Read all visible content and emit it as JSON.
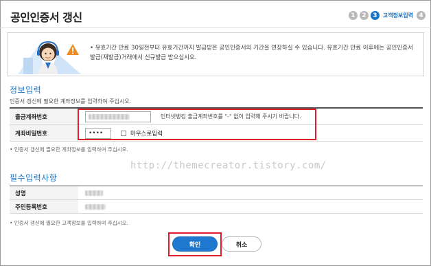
{
  "page": {
    "title": "공인인증서 갱신"
  },
  "steps": {
    "items": [
      "1",
      "2",
      "3",
      "4"
    ],
    "active_index": 2,
    "active_label": "고객정보입력"
  },
  "notice": {
    "text": "• 유효기간 만료 30일전부터 유효기간까지 발급받은 공인인증서의 기간을 연장하실 수 있습니다. 유효기간 만료 이후에는 공인인증서 발급(재발급)거래에서 신규발급 받으십시오."
  },
  "info_section": {
    "title": "정보입력",
    "description": "인증서 갱신에 필요한 계좌정보를 입력하여 주십시오.",
    "rows": {
      "account_label": "출금계좌번호",
      "account_hint": "인터넷뱅킹 출금계좌번호를 \"-\" 없이 입력해 주시기 바랍니다.",
      "password_label": "계좌비밀번호",
      "password_value": "••••",
      "mouse_input_label": "마우스로입력"
    },
    "note": "• 인증서 갱신에 필요한 계좌정보를 입력하여 주십시오."
  },
  "required_section": {
    "title": "필수입력사항",
    "rows": {
      "name_label": "성명",
      "resident_label": "주민등록번호"
    },
    "note": "• 인증서 갱신에 필요한 고객정보를 입력하여 주십시오."
  },
  "watermark": "http://themecreator.tistory.com/",
  "buttons": {
    "confirm": "확인",
    "cancel": "취소"
  },
  "colors": {
    "accent": "#1a73c7",
    "highlight": "#e11d2a",
    "step_inactive": "#b8b8b8"
  }
}
